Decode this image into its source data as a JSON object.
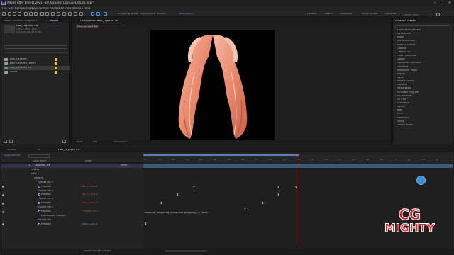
{
  "app": {
    "title": "Adobe After Effects 2021 - D:\\Research Lab\\LiveLib\\Lab.aep *",
    "logo_glyph": "Ae"
  },
  "menu": [
    "File",
    "Edit",
    "Composition",
    "Layer",
    "Effect",
    "Animation",
    "View",
    "Window",
    "Help"
  ],
  "toolbar": {
    "items_left": [
      "Default",
      "Standard",
      "Small Screen",
      "Libraries"
    ],
    "labels_mid": [
      "Snapping",
      "Show",
      "Expressions",
      "Rotate",
      "Resolution"
    ],
    "search_hint": "Search Help"
  },
  "project": {
    "tabs": [
      "Effect Controls: Longhair 1",
      "Project"
    ],
    "selected_name": "Hair_Layered Tut",
    "selected_meta": [
      "1920 x 1080 (1.00)",
      "Δ 0:00:15:00, 29.97 fps"
    ],
    "items": [
      {
        "name": "Hair_Layered",
        "color": "#e0c040",
        "type": "folder"
      },
      {
        "name": "Hair_Layered Layers",
        "color": "#e0c040",
        "type": "folder"
      },
      {
        "name": "Hair_Layered Tut",
        "color": "#e0c040",
        "type": "comp",
        "selected": true
      },
      {
        "name": "Solids",
        "color": "#e0c040",
        "type": "folder"
      }
    ]
  },
  "composition": {
    "tab": "Composition Hair_Layered Tut",
    "breadcrumb": "Hair_Layered Tut",
    "zoom": "100%",
    "quality": "Full",
    "timecode": "0:00:00:00"
  },
  "effects": {
    "tab": "Effects & Presets",
    "items": [
      "* Animation Presets",
      "3D Channel",
      "Audio",
      "Blur & Sharpen",
      "Boris FX Mocha",
      "Channel",
      "CINEMA 4D",
      "Color Correction",
      "Distort",
      "Expression Controls",
      "Generate",
      "Immersive Video",
      "Keying",
      "Matte",
      "Noise & Grain",
      "Obsolete",
      "Perspective",
      "RE:Vision Plug-ins",
      "RG Trapcode",
      "RG VFX",
      "Simulation",
      "Stylize",
      "Text",
      "Time",
      "Transition",
      "Utility",
      "Video Copilot"
    ]
  },
  "timeline": {
    "tabs": [
      "All Hair",
      "Tut",
      "Hair_Layered Tut"
    ],
    "timecode": "0:00:00:00",
    "columns": [
      "Layer Name",
      "Mode"
    ],
    "layer": {
      "index": "1",
      "name": "Longhair_FX",
      "mode": "None"
    },
    "rows": [
      {
        "label": "Effects",
        "indent": 1
      },
      {
        "label": "Mesh 1",
        "indent": 1
      },
      {
        "label": "Deform",
        "indent": 2
      },
      {
        "label": "Puppet Pin 5",
        "indent": 3
      },
      {
        "label": "Position",
        "indent": 4,
        "value": "817.2,384.6"
      },
      {
        "label": "Puppet Pin 4",
        "indent": 3
      },
      {
        "label": "Position",
        "indent": 4,
        "value": "617.2,313.4"
      },
      {
        "label": "Puppet Pin 3",
        "indent": 3
      },
      {
        "label": "Position",
        "indent": 4,
        "value": "857.2,393.7"
      },
      {
        "label": "Puppet Pin 2",
        "indent": 3
      },
      {
        "label": "Position",
        "indent": 4,
        "value": "1299.8,393.7"
      },
      {
        "label": "Expression: Position",
        "indent": 4
      },
      {
        "label": "Puppet Pin 1",
        "indent": 3
      },
      {
        "label": "Position",
        "indent": 4,
        "value": "950.1,232.3",
        "blue": true
      }
    ],
    "expression": "loopOut(\"pingpong\");loopOut(\"pingpong\")+value;",
    "footer": "Toggle Switches / Modes",
    "ruler_labels": [
      "0s",
      "00f",
      "01f",
      "02f",
      "03f",
      "04f",
      "05f",
      "06f",
      "07f",
      "08f",
      "09f",
      "10f",
      "11f",
      "12f",
      "13f",
      "14f",
      "15f",
      "16f",
      "17f",
      "18f",
      "19f",
      "20f"
    ]
  },
  "watermark": {
    "line1": "CG",
    "line2": "MIGHTY"
  }
}
